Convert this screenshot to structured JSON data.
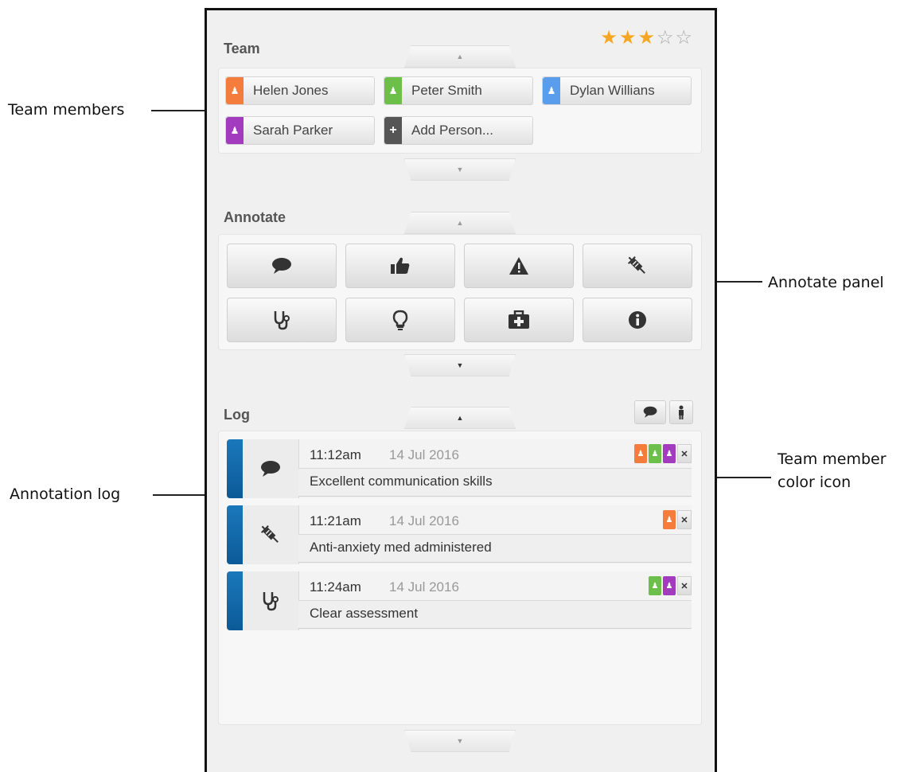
{
  "callouts": {
    "team_members": "Team members",
    "annotation_log": "Annotation log",
    "annotate_panel": "Annotate panel",
    "team_member_color_icon_line1": "Team member",
    "team_member_color_icon_line2": "color icon"
  },
  "rating": {
    "value": 3,
    "max": 5,
    "filled_color": "#f5a623",
    "empty_color": "#aaaaaa"
  },
  "team": {
    "title": "Team",
    "members": [
      {
        "name": "Helen Jones",
        "color": "#f47c3c",
        "icon": "person-icon"
      },
      {
        "name": "Peter Smith",
        "color": "#6cc04a",
        "icon": "person-icon"
      },
      {
        "name": "Dylan Willians",
        "color": "#5b9ded",
        "icon": "person-icon"
      },
      {
        "name": "Sarah Parker",
        "color": "#a23bbd",
        "icon": "person-icon"
      }
    ],
    "add_label": "Add Person...",
    "add_color": "#555555"
  },
  "annotate": {
    "title": "Annotate",
    "buttons": [
      {
        "icon": "speech-bubble-icon"
      },
      {
        "icon": "thumbs-up-icon"
      },
      {
        "icon": "warning-icon"
      },
      {
        "icon": "syringe-icon"
      },
      {
        "icon": "stethoscope-icon"
      },
      {
        "icon": "lightbulb-icon"
      },
      {
        "icon": "medkit-icon"
      },
      {
        "icon": "info-icon"
      }
    ]
  },
  "log": {
    "title": "Log",
    "toggles": [
      {
        "icon": "speech-bubble-icon"
      },
      {
        "icon": "person-icon"
      }
    ],
    "entries": [
      {
        "time": "11:12am",
        "date": "14 Jul 2016",
        "text": "Excellent communication skills",
        "icon": "speech-bubble-icon",
        "tags": [
          "#f47c3c",
          "#6cc04a",
          "#a23bbd"
        ]
      },
      {
        "time": "11:21am",
        "date": "14 Jul 2016",
        "text": "Anti-anxiety med administered",
        "icon": "syringe-icon",
        "tags": [
          "#f47c3c"
        ]
      },
      {
        "time": "11:24am",
        "date": "14 Jul 2016",
        "text": "Clear assessment",
        "icon": "stethoscope-icon",
        "tags": [
          "#6cc04a",
          "#a23bbd"
        ]
      }
    ],
    "accent": "#1a78bb"
  }
}
